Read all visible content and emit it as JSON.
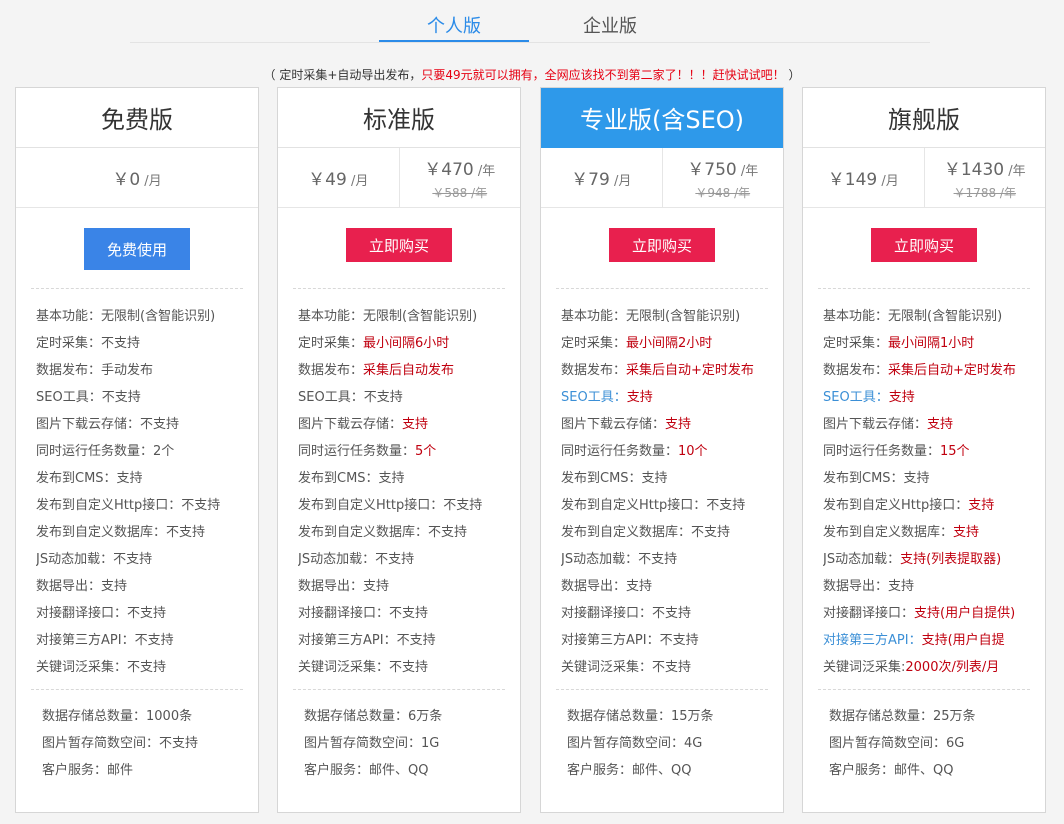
{
  "tabs": {
    "personal": "个人版",
    "enterprise": "企业版"
  },
  "promo": {
    "prefix": "（ 定时采集+自动导出发布，",
    "highlight": "只要49元就可以拥有，全网应该找不到第二家了！！！赶快试试吧！",
    "suffix": " ）"
  },
  "colors": {
    "accent": "#2b8be8",
    "featured_header": "#2e99ea",
    "buy_button": "#e8204e",
    "free_button": "#3a84e7",
    "highlight_text": "#c0000f",
    "link_text": "#3b8fd6"
  },
  "plans": [
    {
      "name": "免费版",
      "prices": [
        {
          "amount": "￥0",
          "unit": " /月"
        }
      ],
      "button": "免费使用",
      "features": [
        {
          "label": "基本功能：",
          "value": "无限制(含智能识别)"
        },
        {
          "label": "定时采集：",
          "value": "不支持"
        },
        {
          "label": "数据发布：",
          "value": "手动发布"
        },
        {
          "label": "SEO工具：",
          "value": "不支持"
        },
        {
          "label": "图片下载云存储：",
          "value": "不支持"
        },
        {
          "label": "同时运行任务数量：",
          "value": "2个"
        },
        {
          "label": "发布到CMS：",
          "value": "支持"
        },
        {
          "label": "发布到自定义Http接口：",
          "value": "不支持"
        },
        {
          "label": "发布到自定义数据库：",
          "value": "不支持"
        },
        {
          "label": "JS动态加载：",
          "value": "不支持"
        },
        {
          "label": "数据导出：",
          "value": "支持"
        },
        {
          "label": "对接翻译接口：",
          "value": "不支持"
        },
        {
          "label": "对接第三方API：",
          "value": "不支持"
        },
        {
          "label": "关键词泛采集：",
          "value": "不支持"
        }
      ],
      "extras": [
        "数据存储总数量：1000条",
        "图片暂存简数空间：不支持",
        "客户服务：邮件"
      ]
    },
    {
      "name": "标准版",
      "prices": [
        {
          "amount": "￥49",
          "unit": " /月"
        },
        {
          "amount": "￥470",
          "unit": " /年",
          "old": "￥588 /年"
        }
      ],
      "button": "立即购买",
      "features": [
        {
          "label": "基本功能：",
          "value": "无限制(含智能识别)"
        },
        {
          "label": "定时采集：",
          "value": "最小间隔6小时",
          "hl": true
        },
        {
          "label": "数据发布：",
          "value": "采集后自动发布",
          "hl": true
        },
        {
          "label": "SEO工具：",
          "value": "不支持"
        },
        {
          "label": "图片下载云存储：",
          "value": "支持",
          "hl": true
        },
        {
          "label": "同时运行任务数量：",
          "value": "5个",
          "hl": true
        },
        {
          "label": "发布到CMS：",
          "value": "支持"
        },
        {
          "label": "发布到自定义Http接口：",
          "value": "不支持"
        },
        {
          "label": "发布到自定义数据库：",
          "value": "不支持"
        },
        {
          "label": "JS动态加载：",
          "value": "不支持"
        },
        {
          "label": "数据导出：",
          "value": "支持"
        },
        {
          "label": "对接翻译接口：",
          "value": "不支持"
        },
        {
          "label": "对接第三方API：",
          "value": "不支持"
        },
        {
          "label": "关键词泛采集：",
          "value": "不支持"
        }
      ],
      "extras": [
        "数据存储总数量：6万条",
        "图片暂存简数空间：1G",
        "客户服务：邮件、QQ"
      ]
    },
    {
      "name": "专业版(含SEO)",
      "featured": true,
      "prices": [
        {
          "amount": "￥79",
          "unit": " /月"
        },
        {
          "amount": "￥750",
          "unit": " /年",
          "old": "￥948 /年"
        }
      ],
      "button": "立即购买",
      "features": [
        {
          "label": "基本功能：",
          "value": "无限制(含智能识别)"
        },
        {
          "label": "定时采集：",
          "value": "最小间隔2小时",
          "hl": true
        },
        {
          "label": "数据发布：",
          "value": "采集后自动+定时发布",
          "hl": true
        },
        {
          "label": "SEO工具：",
          "value": "支持",
          "hl": true,
          "blue_label": true
        },
        {
          "label": "图片下载云存储：",
          "value": "支持",
          "hl": true
        },
        {
          "label": "同时运行任务数量：",
          "value": "10个",
          "hl": true
        },
        {
          "label": "发布到CMS：",
          "value": "支持"
        },
        {
          "label": "发布到自定义Http接口：",
          "value": "不支持"
        },
        {
          "label": "发布到自定义数据库：",
          "value": "不支持"
        },
        {
          "label": "JS动态加载：",
          "value": "不支持"
        },
        {
          "label": "数据导出：",
          "value": "支持"
        },
        {
          "label": "对接翻译接口：",
          "value": "不支持"
        },
        {
          "label": "对接第三方API：",
          "value": "不支持"
        },
        {
          "label": "关键词泛采集：",
          "value": "不支持"
        }
      ],
      "extras": [
        "数据存储总数量：15万条",
        "图片暂存简数空间：4G",
        "客户服务：邮件、QQ"
      ]
    },
    {
      "name": "旗舰版",
      "prices": [
        {
          "amount": "￥149",
          "unit": " /月"
        },
        {
          "amount": "￥1430",
          "unit": " /年",
          "old": "￥1788 /年"
        }
      ],
      "button": "立即购买",
      "features": [
        {
          "label": "基本功能：",
          "value": "无限制(含智能识别)"
        },
        {
          "label": "定时采集：",
          "value": "最小间隔1小时",
          "hl": true
        },
        {
          "label": "数据发布：",
          "value": "采集后自动+定时发布",
          "hl": true
        },
        {
          "label": "SEO工具：",
          "value": "支持",
          "hl": true,
          "blue_label": true
        },
        {
          "label": "图片下载云存储：",
          "value": "支持",
          "hl": true
        },
        {
          "label": "同时运行任务数量：",
          "value": "15个",
          "hl": true
        },
        {
          "label": "发布到CMS：",
          "value": "支持"
        },
        {
          "label": "发布到自定义Http接口：",
          "value": "支持",
          "hl": true
        },
        {
          "label": "发布到自定义数据库：",
          "value": "支持",
          "hl": true
        },
        {
          "label": "JS动态加载：",
          "value": "支持(列表提取器)",
          "hl": true
        },
        {
          "label": "数据导出：",
          "value": "支持"
        },
        {
          "label": "对接翻译接口：",
          "value": "支持(用户自提供)",
          "hl": true
        },
        {
          "label": "对接第三方API：",
          "value": "支持(用户自提",
          "hl": true,
          "blue_label": true
        },
        {
          "label": "关键词泛采集:",
          "value": "2000次/列表/月",
          "hl": true
        }
      ],
      "extras": [
        "数据存储总数量：25万条",
        "图片暂存简数空间：6G",
        "客户服务：邮件、QQ"
      ]
    }
  ]
}
